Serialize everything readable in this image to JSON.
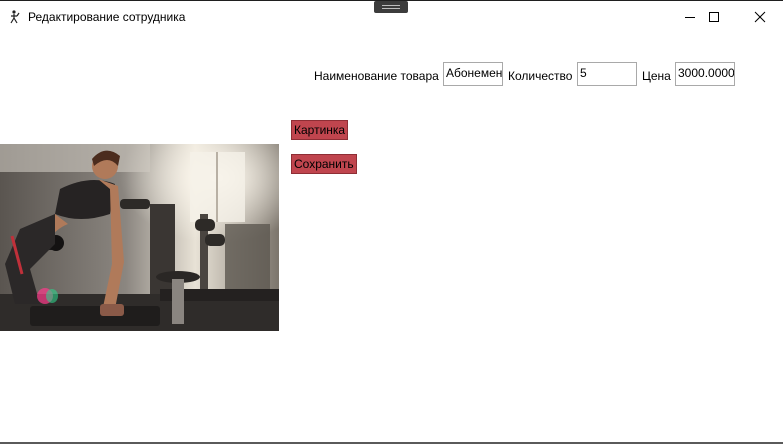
{
  "window": {
    "title": "Редактирование сотрудника",
    "icon": "app-icon",
    "controls": [
      "minimize-icon",
      "maximize-icon",
      "close-icon"
    ]
  },
  "form": {
    "name_label": "Наименование товара",
    "name_value": "Абонемент",
    "quantity_label": "Количество",
    "quantity_value": "5",
    "price_label": "Цена",
    "price_value": "3000.0000"
  },
  "buttons": {
    "image_label": "Картинка",
    "save_label": "Сохранить"
  },
  "colors": {
    "button_bg": "#c0454e",
    "field_border": "#a9a9a9"
  },
  "image": {
    "subject": "woman doing dumbbell row in gym"
  }
}
